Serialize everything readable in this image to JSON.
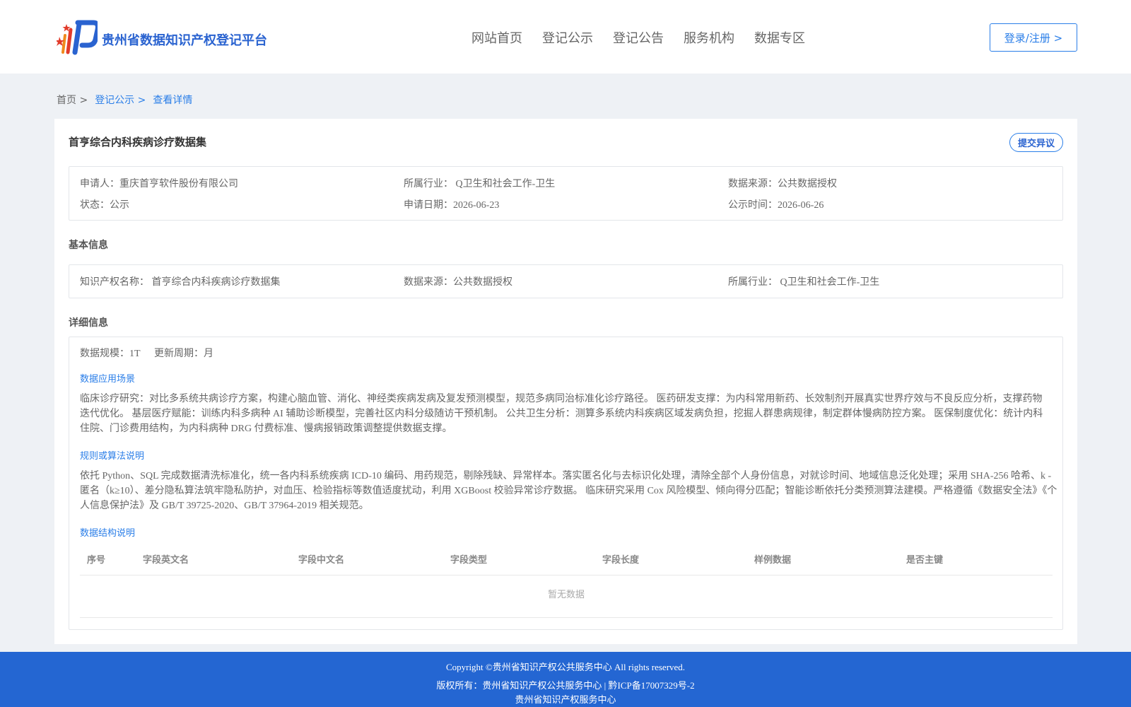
{
  "header": {
    "brand": "贵州省数据知识产权登记平台",
    "nav": [
      "网站首页",
      "登记公示",
      "登记公告",
      "服务机构",
      "数据专区"
    ],
    "login": "登录/注册 >"
  },
  "breadcrumb": {
    "home": "首页 >",
    "public": "登记公示 >",
    "current": "查看详情"
  },
  "detail": {
    "title": "首亨综合内科疾病诊疗数据集",
    "objection_button": "提交异议",
    "summary": {
      "applicant": "申请人：重庆首亨软件股份有限公司",
      "industry": "所属行业： Q卫生和社会工作-卫生",
      "source": "数据来源：公共数据授权",
      "status": "状态：公示",
      "apply_date": "申请日期：2026-06-23",
      "publish_date": "公示时间：2026-06-26"
    },
    "basic": {
      "heading": "基本信息",
      "ip_name": "知识产权名称： 首亨综合内科疾病诊疗数据集",
      "source": "数据来源：公共数据授权",
      "industry": "所属行业： Q卫生和社会工作-卫生"
    },
    "detail_info": {
      "heading": "详细信息",
      "scale": "数据规模：1T",
      "cycle": "更新周期：月",
      "scenario_title": "数据应用场景",
      "scenario_text": "临床诊疗研究：对比多系统共病诊疗方案，构建心脑血管、消化、神经类疾病发病及复发预测模型，规范多病同治标准化诊疗路径。 医药研发支撑：为内科常用新药、长效制剂开展真实世界疗效与不良反应分析，支撑药物迭代优化。 基层医疗赋能：训练内科多病种 AI 辅助诊断模型，完善社区内科分级随访干预机制。 公共卫生分析：测算多系统内科疾病区域发病负担，挖掘人群患病规律，制定群体慢病防控方案。 医保制度优化：统计内科住院、门诊费用结构，为内科病种 DRG 付费标准、慢病报销政策调整提供数据支撑。",
      "algorithm_title": "规则或算法说明",
      "algorithm_text": "依托 Python、SQL 完成数据清洗标准化，统一各内科系统疾病 ICD-10 编码、用药规范，剔除残缺、异常样本。落实匿名化与去标识化处理，清除全部个人身份信息，对就诊时间、地域信息泛化处理；采用 SHA-256 哈希、k - 匿名（k≥10）、差分隐私算法筑牢隐私防护，对血压、检验指标等数值适度扰动，利用 XGBoost 校验异常诊疗数据。 临床研究采用 Cox 风险模型、倾向得分匹配；智能诊断依托分类预测算法建模。严格遵循《数据安全法》《个人信息保护法》及 GB/T 39725-2020、GB/T 37964-2019 相关规范。",
      "structure_title": "数据结构说明",
      "table_headers": [
        "序号",
        "字段英文名",
        "字段中文名",
        "字段类型",
        "字段长度",
        "样例数据",
        "是否主键"
      ],
      "empty_text": "暂无数据"
    }
  },
  "footer": {
    "copyright": "Copyright ©贵州省知识产权公共服务中心 All rights reserved.",
    "owner": "版权所有：贵州省知识产权公共服务中心 | 黔ICP备17007329号-2",
    "org": "贵州省知识产权服务中心"
  },
  "colors": {
    "primary": "#2a7ee8",
    "brand": "#2a63d0",
    "footer": "#2466d2",
    "logo_red": "#e23b2a",
    "logo_orange": "#f08a1c"
  }
}
